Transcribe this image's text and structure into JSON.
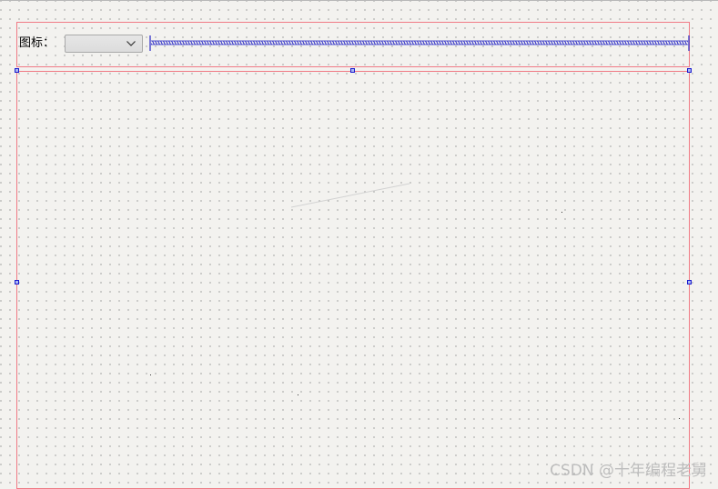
{
  "form": {
    "icon_label": "图标：",
    "icon_combo": {
      "selected": ""
    }
  },
  "watermark": "CSDN @十年编程老舅",
  "icons": {
    "combo_arrow": "chevron-down-icon"
  },
  "colors": {
    "canvas": "#f3f2ef",
    "layout_border": "#f07a85",
    "spacer": "#2222c4",
    "selection_handle_border": "#1a1acf",
    "selection_handle_fill": "#a9b8f2"
  }
}
